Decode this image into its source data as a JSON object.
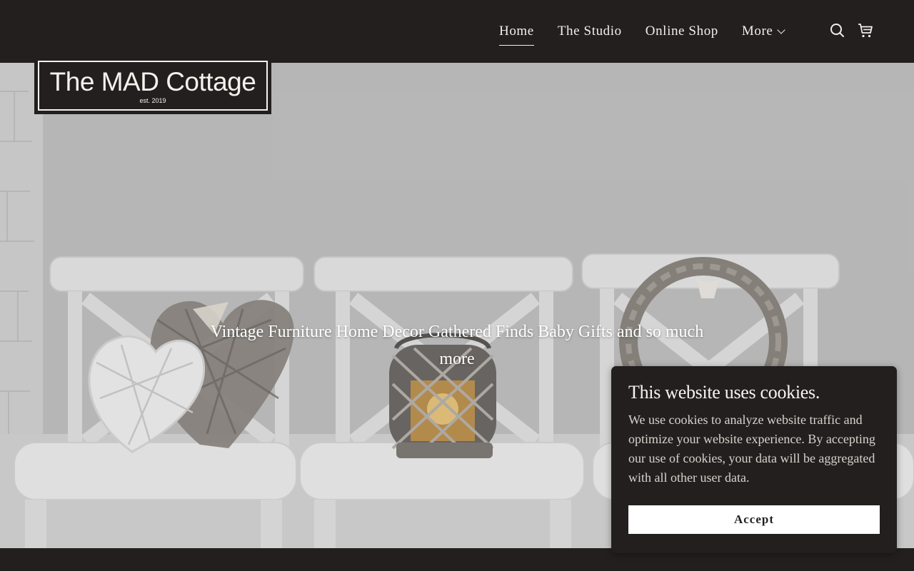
{
  "nav": {
    "items": [
      {
        "label": "Home",
        "active": true
      },
      {
        "label": "The Studio",
        "active": false
      },
      {
        "label": "Online Shop",
        "active": false
      },
      {
        "label": "More",
        "active": false,
        "has_dropdown": true
      }
    ],
    "icons": [
      "search-icon",
      "cart-icon"
    ]
  },
  "logo": {
    "name": "The MAD Cottage",
    "est": "est. 2019"
  },
  "hero": {
    "tagline": "Vintage Furniture Home Decor Gathered Finds Baby Gifts and so much more"
  },
  "cookie": {
    "title": "This website uses cookies.",
    "body": "We use cookies to analyze website traffic and optimize your website experience. By accepting our use of cookies, your data will be aggregated with all other user data.",
    "accept_label": "Accept"
  },
  "colors": {
    "header_bg": "#231f1f",
    "nav_text": "#f2efe9",
    "button_bg": "#ffffff"
  }
}
